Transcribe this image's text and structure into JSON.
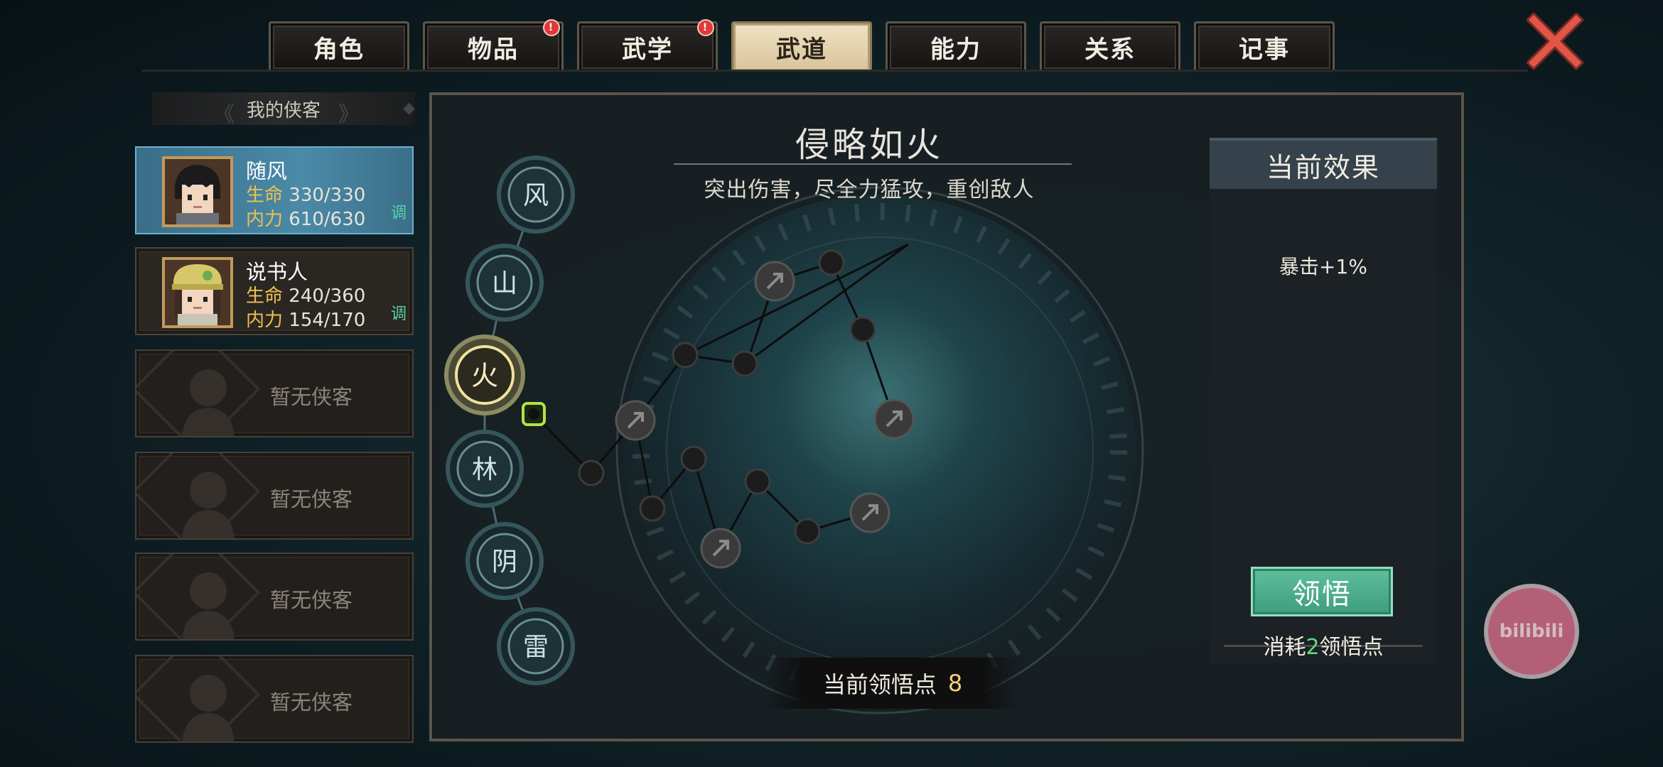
{
  "tabs": [
    {
      "label": "角色",
      "badge": false
    },
    {
      "label": "物品",
      "badge": true
    },
    {
      "label": "武学",
      "badge": true
    },
    {
      "label": "武道",
      "badge": false,
      "active": true
    },
    {
      "label": "能力",
      "badge": false
    },
    {
      "label": "关系",
      "badge": false
    },
    {
      "label": "记事",
      "badge": false
    }
  ],
  "badge_symbol": "!",
  "roster": {
    "header": "我的侠客",
    "characters": [
      {
        "name": "随风",
        "hp_label": "生命",
        "hp": "330/330",
        "mp_label": "内力",
        "mp": "610/630",
        "adjust": "调",
        "selected": true
      },
      {
        "name": "说书人",
        "hp_label": "生命",
        "hp": "240/360",
        "mp_label": "内力",
        "mp": "154/170",
        "adjust": "调",
        "selected": false
      }
    ],
    "empty_slots": [
      "暂无侠客",
      "暂无侠客",
      "暂无侠客",
      "暂无侠客"
    ]
  },
  "paths": [
    "风",
    "山",
    "火",
    "林",
    "阴",
    "雷"
  ],
  "selected_path": "火",
  "main": {
    "title": "侵略如火",
    "description": "突出伤害，尽全力猛攻，重创敌人",
    "points_label": "当前领悟点",
    "points_value": "8"
  },
  "effect": {
    "header": "当前效果",
    "text": "暴击+1%",
    "button": "领悟",
    "cost_prefix": "消耗",
    "cost_value": "2",
    "cost_suffix": "领悟点"
  },
  "watermark": "bilibili",
  "colors": {
    "accent_green": "#5fbf9d",
    "tab_active": "#e6d4ae",
    "selected_card": "#4a8aa8",
    "stat_key": "#f0c050",
    "badge_red": "#e0393a"
  }
}
